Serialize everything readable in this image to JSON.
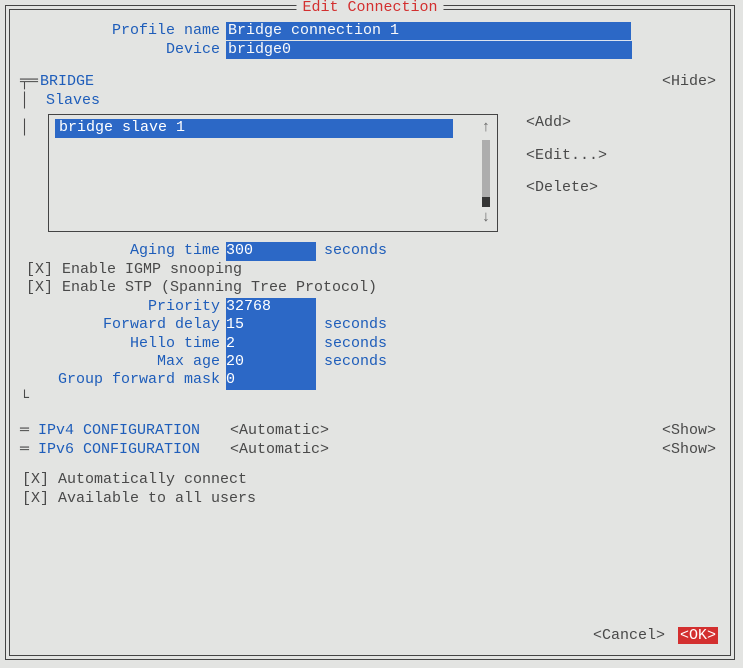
{
  "window_title": "Edit Connection",
  "fields": {
    "profile_name_label": "Profile name",
    "profile_name_value": "Bridge connection 1",
    "device_label": "Device",
    "device_value": "bridge0"
  },
  "bridge_section": {
    "title": "BRIDGE",
    "hide_btn": "<Hide>",
    "slaves_label": "Slaves",
    "slaves": [
      "bridge slave 1"
    ],
    "btn_add": "<Add>",
    "btn_edit": "<Edit...>",
    "btn_delete": "<Delete>",
    "aging_label": "Aging time",
    "aging_value": "300",
    "aging_units": "seconds",
    "igmp_label": "[X] Enable IGMP snooping",
    "stp_label": "[X] Enable STP (Spanning Tree Protocol)",
    "priority_label": "Priority",
    "priority_value": "32768",
    "fwd_label": "Forward delay",
    "fwd_value": "15",
    "fwd_units": "seconds",
    "hello_label": "Hello time",
    "hello_value": "2",
    "hello_units": "seconds",
    "maxage_label": "Max age",
    "maxage_value": "20",
    "maxage_units": "seconds",
    "gfm_label": "Group forward mask",
    "gfm_value": "0"
  },
  "ipv4": {
    "label": "IPv4 CONFIGURATION",
    "value": "<Automatic>",
    "btn": "<Show>"
  },
  "ipv6": {
    "label": "IPv6 CONFIGURATION",
    "value": "<Automatic>",
    "btn": "<Show>"
  },
  "auto_connect": "[X] Automatically connect",
  "avail_all": "[X] Available to all users",
  "cancel_btn": "<Cancel>",
  "ok_btn": "<OK>"
}
